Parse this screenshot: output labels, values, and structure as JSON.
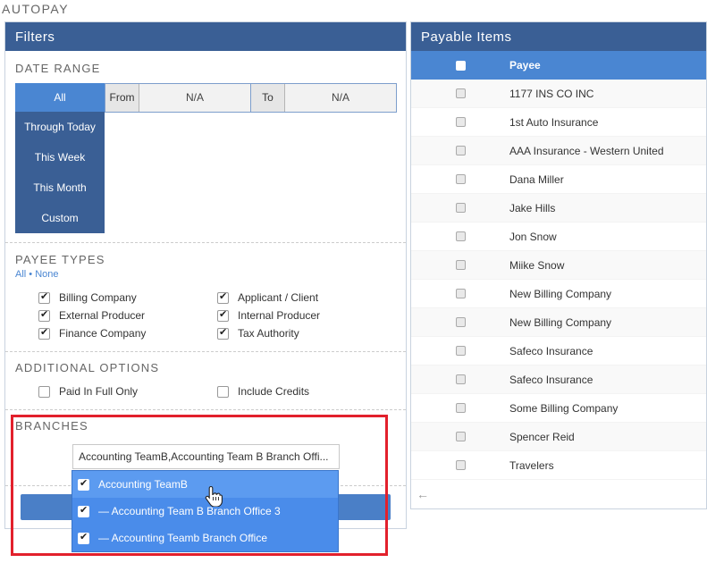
{
  "page_title": "AUTOPAY",
  "filters": {
    "header": "Filters",
    "date_range": {
      "title": "DATE RANGE",
      "options": [
        "All",
        "Through Today",
        "This Week",
        "This Month",
        "Custom"
      ],
      "from_label": "From",
      "from_value": "N/A",
      "to_label": "To",
      "to_value": "N/A"
    },
    "payee_types": {
      "title": "PAYEE TYPES",
      "link_all": "All",
      "separator": "•",
      "link_none": "None",
      "items": [
        {
          "label": "Billing Company",
          "checked": true
        },
        {
          "label": "Applicant / Client",
          "checked": true
        },
        {
          "label": "External Producer",
          "checked": true
        },
        {
          "label": "Internal Producer",
          "checked": true
        },
        {
          "label": "Finance Company",
          "checked": true
        },
        {
          "label": "Tax Authority",
          "checked": true
        }
      ]
    },
    "additional_options": {
      "title": "ADDITIONAL OPTIONS",
      "items": [
        {
          "label": "Paid In Full Only",
          "checked": false
        },
        {
          "label": "Include Credits",
          "checked": false
        }
      ]
    },
    "branches": {
      "title": "BRANCHES",
      "selected_text": "Accounting TeamB,Accounting Team B Branch Offi...",
      "options": [
        {
          "label": "Accounting TeamB",
          "checked": true
        },
        {
          "label": "— Accounting Team B Branch Office 3",
          "checked": true
        },
        {
          "label": "— Accounting Teamb Branch Office",
          "checked": true
        }
      ]
    }
  },
  "payable": {
    "header": "Payable Items",
    "column_payee": "Payee",
    "rows": [
      "1177 INS CO INC",
      "1st Auto Insurance",
      "AAA Insurance - Western United",
      "Dana Miller",
      "Jake Hills",
      "Jon Snow",
      "Miike Snow",
      "New Billing Company",
      "New Billing Company",
      "Safeco Insurance",
      "Safeco Insurance",
      "Some Billing Company",
      "Spencer Reid",
      "Travelers"
    ],
    "back_arrow": "←"
  },
  "colors": {
    "header_blue": "#3a5f95",
    "accent_blue": "#4a86d2",
    "dropdown_blue": "#4a8cea",
    "highlight_red": "#e2202c"
  }
}
